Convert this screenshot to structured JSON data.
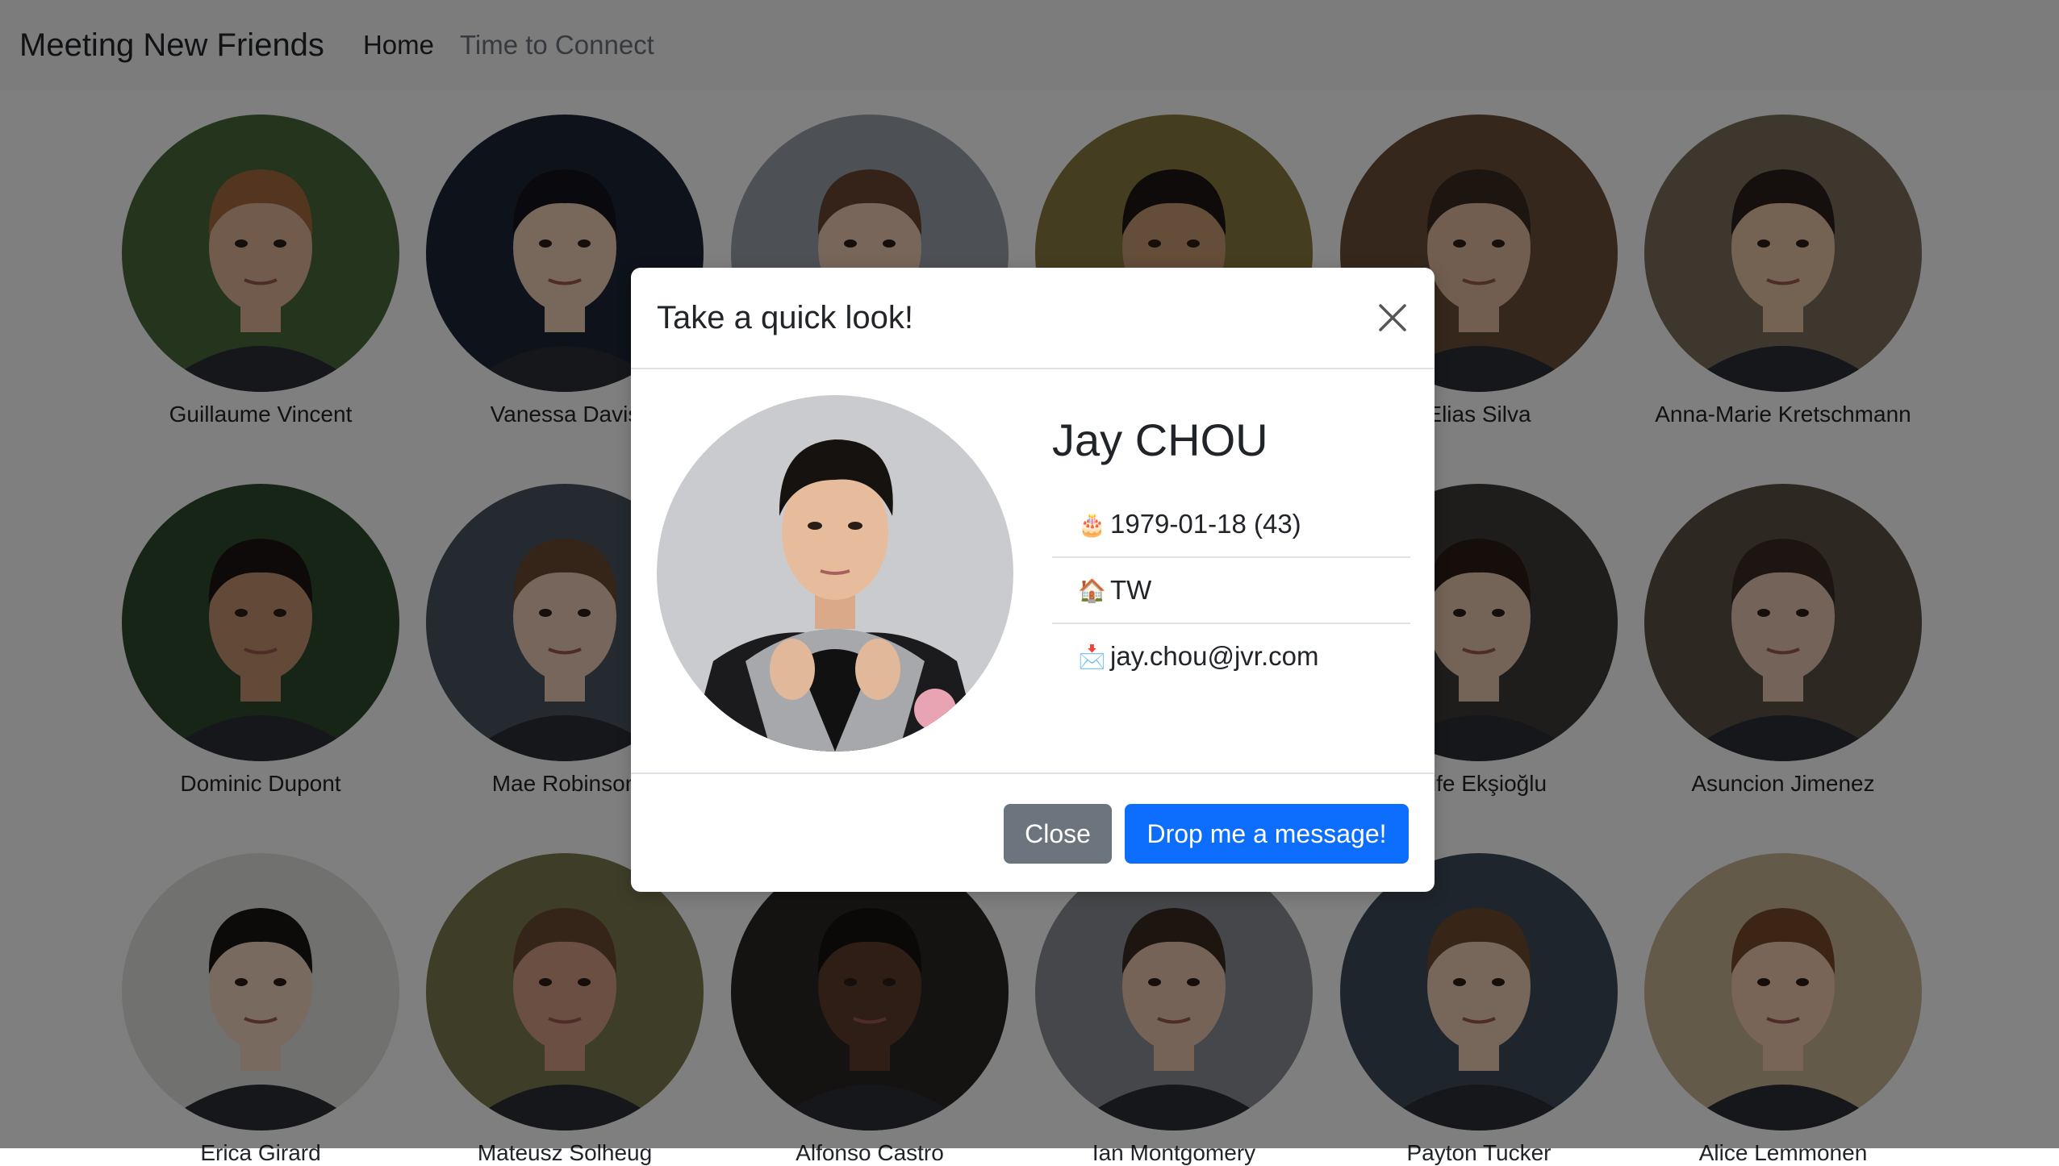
{
  "navbar": {
    "brand": "Meeting New Friends",
    "links": [
      {
        "label": "Home"
      },
      {
        "label": "Time to Connect"
      }
    ]
  },
  "friends": [
    {
      "name": "Guillaume Vincent",
      "bg": "#4a6b3a",
      "skin": "#e0b79a",
      "hair": "#a86a3e"
    },
    {
      "name": "Vanessa Davis",
      "bg": "#1c2434",
      "skin": "#f0d0b8",
      "hair": "#15131a"
    },
    {
      "name": "",
      "bg": "#9aa0a8",
      "skin": "#f1cdb4",
      "hair": "#6b4430"
    },
    {
      "name": "",
      "bg": "#8a7a3e",
      "skin": "#c89a72",
      "hair": "#1c1714"
    },
    {
      "name": "Elias Silva",
      "bg": "#6b4e36",
      "skin": "#e3bda0",
      "hair": "#3a2a20"
    },
    {
      "name": "Anna-Marie Kretschmann",
      "bg": "#7d6e5a",
      "skin": "#e9c4a6",
      "hair": "#2a1f1a"
    },
    {
      "name": "Dominic Dupont",
      "bg": "#2d4a2a",
      "skin": "#c59270",
      "hair": "#1a1412"
    },
    {
      "name": "Mae Robinson",
      "bg": "#4a5560",
      "skin": "#efccb6",
      "hair": "#6a4a33"
    },
    {
      "name": "",
      "bg": "#8a8f96",
      "skin": "#e6c0a0",
      "hair": "#3c2a20"
    },
    {
      "name": "",
      "bg": "#6a6e74",
      "skin": "#e0b796",
      "hair": "#2a201a"
    },
    {
      "name": "Elife Ekşioğlu",
      "bg": "#3f3a36",
      "skin": "#e9c8ae",
      "hair": "#2b1d16"
    },
    {
      "name": "Asuncion Jimenez",
      "bg": "#5a5245",
      "skin": "#e8c7b2",
      "hair": "#3a2b22"
    },
    {
      "name": "Erica Girard",
      "bg": "#e2e3e0",
      "skin": "#f2d4c0",
      "hair": "#1b1614"
    },
    {
      "name": "Mateusz Solheug",
      "bg": "#7d7a50",
      "skin": "#d89f86",
      "hair": "#6b4b33"
    },
    {
      "name": "Alfonso Castro",
      "bg": "#2a2724",
      "skin": "#5e3d2a",
      "hair": "#151210"
    },
    {
      "name": "Ian Montgomery",
      "bg": "#8c8f94",
      "skin": "#ecc6ae",
      "hair": "#3b2a20"
    },
    {
      "name": "Payton Tucker",
      "bg": "#3e4a58",
      "skin": "#efccb4",
      "hair": "#6e4a30"
    },
    {
      "name": "Alice Lemmonen",
      "bg": "#c9b595",
      "skin": "#f0caae",
      "hair": "#7a4a2a"
    }
  ],
  "modal": {
    "title": "Take a quick look!",
    "close_icon": "close-icon",
    "person": {
      "name": "Jay CHOU",
      "birthday_icon": "🎂",
      "birthday": "1979-01-18 (43)",
      "home_icon": "🏠",
      "country": "TW",
      "mail_icon": "📩",
      "email": "jay.chou@jvr.com"
    },
    "buttons": {
      "close": "Close",
      "message": "Drop me a message!"
    }
  },
  "colors": {
    "primary": "#0d6efd",
    "secondary": "#6c757d",
    "backdrop": "rgba(0,0,0,0.5)"
  }
}
